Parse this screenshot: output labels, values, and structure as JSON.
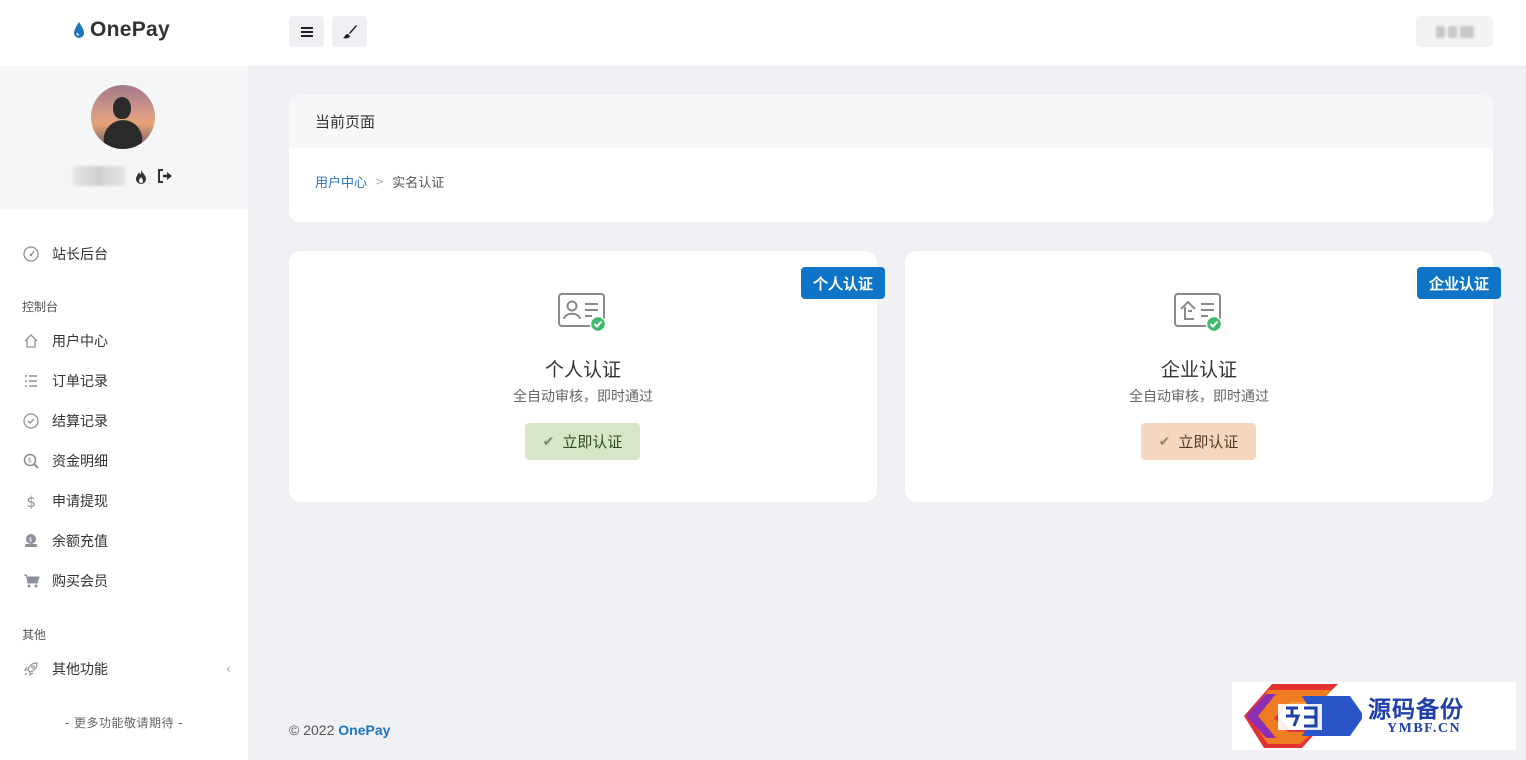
{
  "brand": {
    "name": "OnePay"
  },
  "nav": {
    "top_item": "站长后台",
    "section1": "控制台",
    "items": [
      "用户中心",
      "订单记录",
      "结算记录",
      "资金明细",
      "申请提现",
      "余额充值",
      "购买会员"
    ],
    "section2": "其他",
    "other_item": "其他功能",
    "more": "- 更多功能敬请期待 -"
  },
  "breadcrumb": {
    "header": "当前页面",
    "link": "用户中心",
    "current": "实名认证"
  },
  "cards": [
    {
      "badge": "个人认证",
      "title": "个人认证",
      "desc": "全自动审核，即时通过",
      "button": "立即认证"
    },
    {
      "badge": "企业认证",
      "title": "企业认证",
      "desc": "全自动审核，即时通过",
      "button": "立即认证"
    }
  ],
  "footer": {
    "copyright": "© 2022",
    "brand": "OnePay"
  },
  "watermark": {
    "text_cn": "源码备份",
    "text_en": "YMBF.CN"
  },
  "colors": {
    "accent": "#0d74c7",
    "link": "#2a74b8",
    "btn_green": "#d7e6c6",
    "btn_orange": "#f4d7be"
  }
}
